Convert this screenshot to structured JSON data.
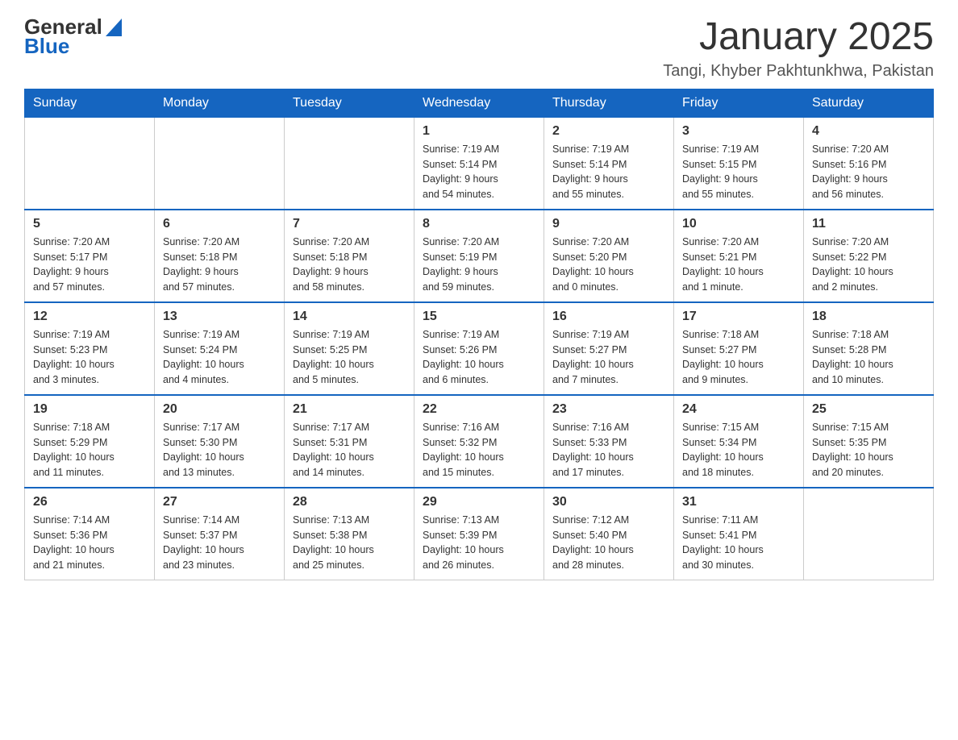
{
  "header": {
    "logo_general": "General",
    "logo_blue": "Blue",
    "title": "January 2025",
    "subtitle": "Tangi, Khyber Pakhtunkhwa, Pakistan"
  },
  "days_of_week": [
    "Sunday",
    "Monday",
    "Tuesday",
    "Wednesday",
    "Thursday",
    "Friday",
    "Saturday"
  ],
  "weeks": [
    [
      {
        "day": "",
        "info": ""
      },
      {
        "day": "",
        "info": ""
      },
      {
        "day": "",
        "info": ""
      },
      {
        "day": "1",
        "info": "Sunrise: 7:19 AM\nSunset: 5:14 PM\nDaylight: 9 hours\nand 54 minutes."
      },
      {
        "day": "2",
        "info": "Sunrise: 7:19 AM\nSunset: 5:14 PM\nDaylight: 9 hours\nand 55 minutes."
      },
      {
        "day": "3",
        "info": "Sunrise: 7:19 AM\nSunset: 5:15 PM\nDaylight: 9 hours\nand 55 minutes."
      },
      {
        "day": "4",
        "info": "Sunrise: 7:20 AM\nSunset: 5:16 PM\nDaylight: 9 hours\nand 56 minutes."
      }
    ],
    [
      {
        "day": "5",
        "info": "Sunrise: 7:20 AM\nSunset: 5:17 PM\nDaylight: 9 hours\nand 57 minutes."
      },
      {
        "day": "6",
        "info": "Sunrise: 7:20 AM\nSunset: 5:18 PM\nDaylight: 9 hours\nand 57 minutes."
      },
      {
        "day": "7",
        "info": "Sunrise: 7:20 AM\nSunset: 5:18 PM\nDaylight: 9 hours\nand 58 minutes."
      },
      {
        "day": "8",
        "info": "Sunrise: 7:20 AM\nSunset: 5:19 PM\nDaylight: 9 hours\nand 59 minutes."
      },
      {
        "day": "9",
        "info": "Sunrise: 7:20 AM\nSunset: 5:20 PM\nDaylight: 10 hours\nand 0 minutes."
      },
      {
        "day": "10",
        "info": "Sunrise: 7:20 AM\nSunset: 5:21 PM\nDaylight: 10 hours\nand 1 minute."
      },
      {
        "day": "11",
        "info": "Sunrise: 7:20 AM\nSunset: 5:22 PM\nDaylight: 10 hours\nand 2 minutes."
      }
    ],
    [
      {
        "day": "12",
        "info": "Sunrise: 7:19 AM\nSunset: 5:23 PM\nDaylight: 10 hours\nand 3 minutes."
      },
      {
        "day": "13",
        "info": "Sunrise: 7:19 AM\nSunset: 5:24 PM\nDaylight: 10 hours\nand 4 minutes."
      },
      {
        "day": "14",
        "info": "Sunrise: 7:19 AM\nSunset: 5:25 PM\nDaylight: 10 hours\nand 5 minutes."
      },
      {
        "day": "15",
        "info": "Sunrise: 7:19 AM\nSunset: 5:26 PM\nDaylight: 10 hours\nand 6 minutes."
      },
      {
        "day": "16",
        "info": "Sunrise: 7:19 AM\nSunset: 5:27 PM\nDaylight: 10 hours\nand 7 minutes."
      },
      {
        "day": "17",
        "info": "Sunrise: 7:18 AM\nSunset: 5:27 PM\nDaylight: 10 hours\nand 9 minutes."
      },
      {
        "day": "18",
        "info": "Sunrise: 7:18 AM\nSunset: 5:28 PM\nDaylight: 10 hours\nand 10 minutes."
      }
    ],
    [
      {
        "day": "19",
        "info": "Sunrise: 7:18 AM\nSunset: 5:29 PM\nDaylight: 10 hours\nand 11 minutes."
      },
      {
        "day": "20",
        "info": "Sunrise: 7:17 AM\nSunset: 5:30 PM\nDaylight: 10 hours\nand 13 minutes."
      },
      {
        "day": "21",
        "info": "Sunrise: 7:17 AM\nSunset: 5:31 PM\nDaylight: 10 hours\nand 14 minutes."
      },
      {
        "day": "22",
        "info": "Sunrise: 7:16 AM\nSunset: 5:32 PM\nDaylight: 10 hours\nand 15 minutes."
      },
      {
        "day": "23",
        "info": "Sunrise: 7:16 AM\nSunset: 5:33 PM\nDaylight: 10 hours\nand 17 minutes."
      },
      {
        "day": "24",
        "info": "Sunrise: 7:15 AM\nSunset: 5:34 PM\nDaylight: 10 hours\nand 18 minutes."
      },
      {
        "day": "25",
        "info": "Sunrise: 7:15 AM\nSunset: 5:35 PM\nDaylight: 10 hours\nand 20 minutes."
      }
    ],
    [
      {
        "day": "26",
        "info": "Sunrise: 7:14 AM\nSunset: 5:36 PM\nDaylight: 10 hours\nand 21 minutes."
      },
      {
        "day": "27",
        "info": "Sunrise: 7:14 AM\nSunset: 5:37 PM\nDaylight: 10 hours\nand 23 minutes."
      },
      {
        "day": "28",
        "info": "Sunrise: 7:13 AM\nSunset: 5:38 PM\nDaylight: 10 hours\nand 25 minutes."
      },
      {
        "day": "29",
        "info": "Sunrise: 7:13 AM\nSunset: 5:39 PM\nDaylight: 10 hours\nand 26 minutes."
      },
      {
        "day": "30",
        "info": "Sunrise: 7:12 AM\nSunset: 5:40 PM\nDaylight: 10 hours\nand 28 minutes."
      },
      {
        "day": "31",
        "info": "Sunrise: 7:11 AM\nSunset: 5:41 PM\nDaylight: 10 hours\nand 30 minutes."
      },
      {
        "day": "",
        "info": ""
      }
    ]
  ]
}
